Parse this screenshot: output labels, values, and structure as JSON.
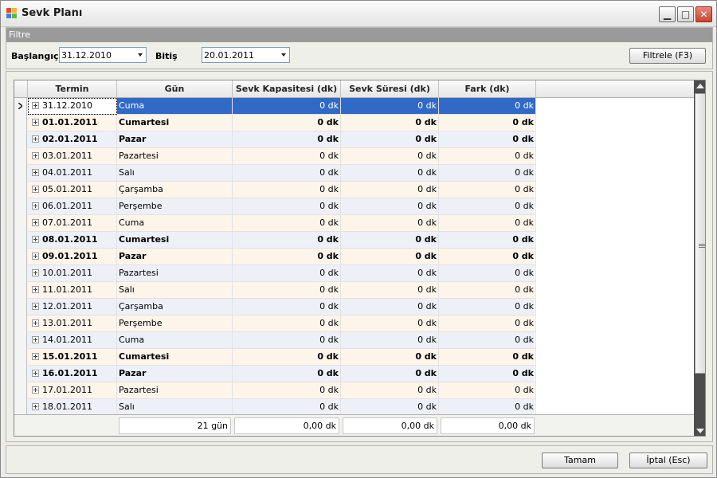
{
  "window": {
    "title": "Sevk Planı"
  },
  "filter": {
    "header": "Filtre",
    "start_label": "Başlangıç",
    "start_value": "31.12.2010",
    "end_label": "Bitiş",
    "end_value": "20.01.2011",
    "filter_button": "Filtrele (F3)"
  },
  "grid": {
    "columns": [
      "Termin",
      "Gün",
      "Sevk Kapasitesi (dk)",
      "Sevk Süresi (dk)",
      "Fark (dk)"
    ],
    "rows": [
      {
        "termin": "31.12.2010",
        "gun": "Cuma",
        "kap": "0 dk",
        "sure": "0 dk",
        "fark": "0 dk",
        "bold": false,
        "selected": true
      },
      {
        "termin": "01.01.2011",
        "gun": "Cumartesi",
        "kap": "0 dk",
        "sure": "0 dk",
        "fark": "0 dk",
        "bold": true,
        "selected": false
      },
      {
        "termin": "02.01.2011",
        "gun": "Pazar",
        "kap": "0 dk",
        "sure": "0 dk",
        "fark": "0 dk",
        "bold": true,
        "selected": false
      },
      {
        "termin": "03.01.2011",
        "gun": "Pazartesi",
        "kap": "0 dk",
        "sure": "0 dk",
        "fark": "0 dk",
        "bold": false,
        "selected": false
      },
      {
        "termin": "04.01.2011",
        "gun": "Salı",
        "kap": "0 dk",
        "sure": "0 dk",
        "fark": "0 dk",
        "bold": false,
        "selected": false
      },
      {
        "termin": "05.01.2011",
        "gun": "Çarşamba",
        "kap": "0 dk",
        "sure": "0 dk",
        "fark": "0 dk",
        "bold": false,
        "selected": false
      },
      {
        "termin": "06.01.2011",
        "gun": "Perşembe",
        "kap": "0 dk",
        "sure": "0 dk",
        "fark": "0 dk",
        "bold": false,
        "selected": false
      },
      {
        "termin": "07.01.2011",
        "gun": "Cuma",
        "kap": "0 dk",
        "sure": "0 dk",
        "fark": "0 dk",
        "bold": false,
        "selected": false
      },
      {
        "termin": "08.01.2011",
        "gun": "Cumartesi",
        "kap": "0 dk",
        "sure": "0 dk",
        "fark": "0 dk",
        "bold": true,
        "selected": false
      },
      {
        "termin": "09.01.2011",
        "gun": "Pazar",
        "kap": "0 dk",
        "sure": "0 dk",
        "fark": "0 dk",
        "bold": true,
        "selected": false
      },
      {
        "termin": "10.01.2011",
        "gun": "Pazartesi",
        "kap": "0 dk",
        "sure": "0 dk",
        "fark": "0 dk",
        "bold": false,
        "selected": false
      },
      {
        "termin": "11.01.2011",
        "gun": "Salı",
        "kap": "0 dk",
        "sure": "0 dk",
        "fark": "0 dk",
        "bold": false,
        "selected": false
      },
      {
        "termin": "12.01.2011",
        "gun": "Çarşamba",
        "kap": "0 dk",
        "sure": "0 dk",
        "fark": "0 dk",
        "bold": false,
        "selected": false
      },
      {
        "termin": "13.01.2011",
        "gun": "Perşembe",
        "kap": "0 dk",
        "sure": "0 dk",
        "fark": "0 dk",
        "bold": false,
        "selected": false
      },
      {
        "termin": "14.01.2011",
        "gun": "Cuma",
        "kap": "0 dk",
        "sure": "0 dk",
        "fark": "0 dk",
        "bold": false,
        "selected": false
      },
      {
        "termin": "15.01.2011",
        "gun": "Cumartesi",
        "kap": "0 dk",
        "sure": "0 dk",
        "fark": "0 dk",
        "bold": true,
        "selected": false
      },
      {
        "termin": "16.01.2011",
        "gun": "Pazar",
        "kap": "0 dk",
        "sure": "0 dk",
        "fark": "0 dk",
        "bold": true,
        "selected": false
      },
      {
        "termin": "17.01.2011",
        "gun": "Pazartesi",
        "kap": "0 dk",
        "sure": "0 dk",
        "fark": "0 dk",
        "bold": false,
        "selected": false
      },
      {
        "termin": "18.01.2011",
        "gun": "Salı",
        "kap": "0 dk",
        "sure": "0 dk",
        "fark": "0 dk",
        "bold": false,
        "selected": false
      }
    ],
    "footer": {
      "gun": "21 gün",
      "kap": "0,00 dk",
      "sure": "0,00 dk",
      "fark": "0,00 dk"
    }
  },
  "buttons": {
    "ok": "Tamam",
    "cancel": "İptal (Esc)"
  },
  "colors": {
    "selection": "#3169c6",
    "odd_row": "#eef0f8",
    "even_row": "#fdf4ea"
  }
}
